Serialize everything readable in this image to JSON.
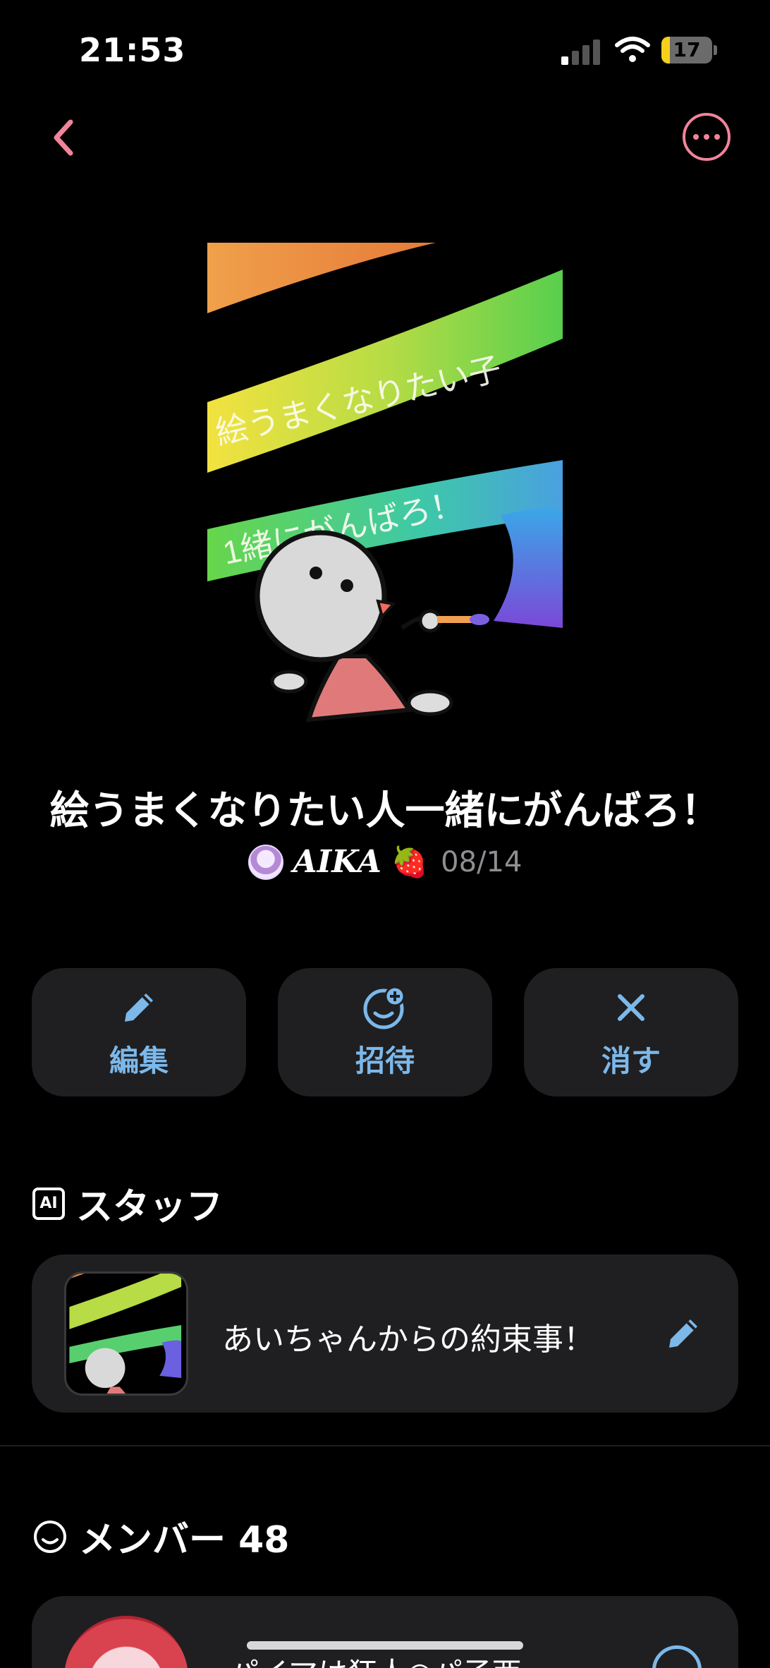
{
  "status_bar": {
    "time": "21:53",
    "battery": "17"
  },
  "post": {
    "title": "絵うまくなりたい人一緒にがんばろ！",
    "author": "AIKA",
    "author_emoji": "🍓",
    "date": "08/14",
    "cover_art_text": [
      "絵うまくなりたい子",
      "1緒にがんばろ！"
    ]
  },
  "actions": [
    {
      "label": "編集",
      "icon": "pencil-icon"
    },
    {
      "label": "招待",
      "icon": "add-person-icon"
    },
    {
      "label": "消す",
      "icon": "close-icon"
    }
  ],
  "staff_section": {
    "badge": "AI",
    "heading": "スタッフ",
    "item": {
      "title": "あいちゃんからの約束事！"
    }
  },
  "member_section": {
    "heading": "メンバー 48",
    "first_member_name_partial": "パイマは狂人◎パ子西"
  },
  "colors": {
    "accent_pink": "#f2849a",
    "accent_blue": "#7cb8ea",
    "card_bg": "#1f1f21"
  }
}
